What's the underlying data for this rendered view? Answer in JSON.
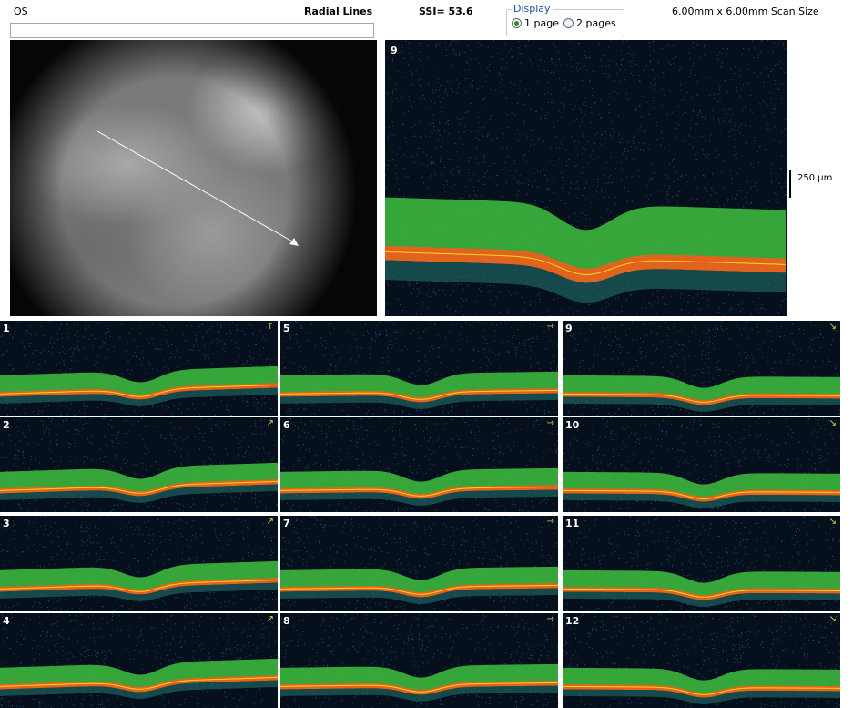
{
  "header": {
    "eye": "OS",
    "protocol": "Radial Lines",
    "ssi": "SSI= 53.6",
    "scan_size": "6.00mm x 6.00mm Scan Size"
  },
  "display": {
    "legend": "Display",
    "options": [
      {
        "label": "1 page",
        "selected": true
      },
      {
        "label": "2 pages",
        "selected": false
      }
    ]
  },
  "main_scan": {
    "number": "9",
    "scale_label": "250 µm"
  },
  "thumbnails": [
    "1",
    "2",
    "3",
    "4",
    "5",
    "6",
    "7",
    "8",
    "9",
    "10",
    "11",
    "12"
  ],
  "colors": {
    "background": "#05101c",
    "rnfl": "#3fbf3f",
    "rpe": "#e0641e",
    "rpe_core": "#ffd21e",
    "noise": "#1f4f7a"
  }
}
